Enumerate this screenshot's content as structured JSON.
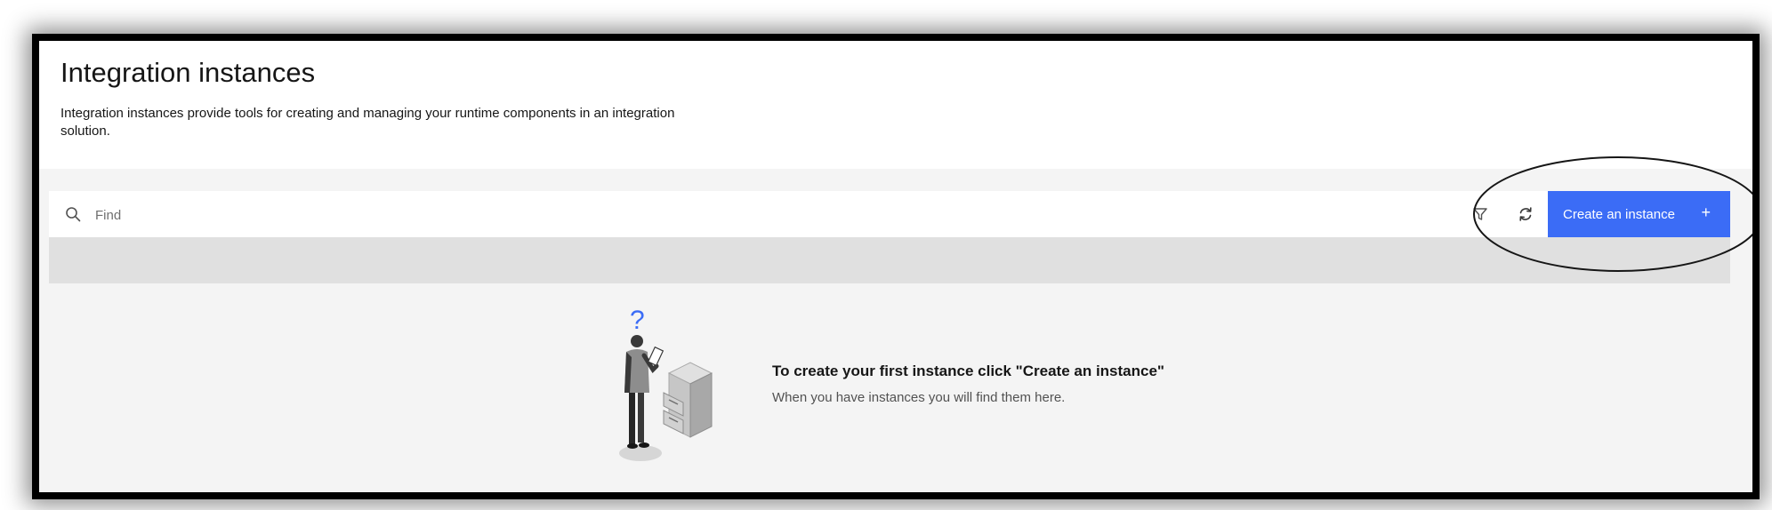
{
  "header": {
    "title": "Integration instances",
    "description": "Integration instances provide tools for creating and managing your runtime components in an integration solution."
  },
  "toolbar": {
    "search_placeholder": "Find",
    "search_value": "",
    "search_icon": "search-icon",
    "filter_icon": "filter-icon",
    "refresh_icon": "refresh-icon",
    "create_label": "Create an instance",
    "create_icon": "+"
  },
  "empty_state": {
    "title": "To create your first instance click \"Create an instance\"",
    "subtitle": "When you have instances you will find them here.",
    "illustration_mark": "?"
  },
  "colors": {
    "primary_button": "#3b6cf6",
    "page_background": "#f4f4f4",
    "table_header": "#e0e0e0",
    "question_mark": "#3b6cf6"
  }
}
